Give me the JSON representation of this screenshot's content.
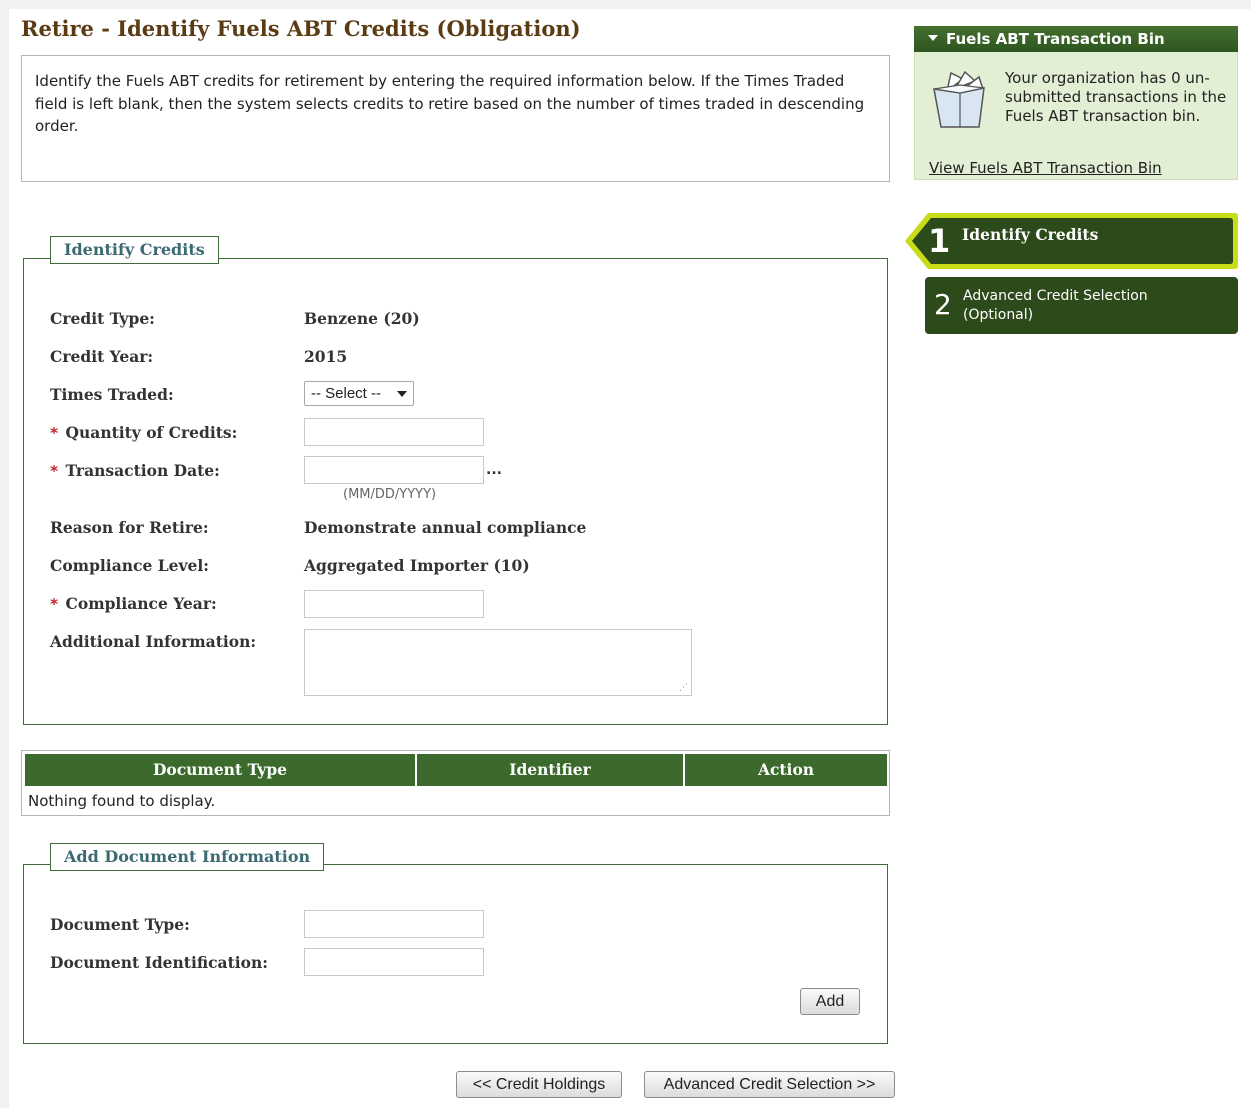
{
  "page": {
    "title": "Retire - Identify Fuels ABT Credits (Obligation)",
    "intro": "Identify the Fuels ABT credits for retirement by entering the required information below. If the Times Traded field is left blank, then the system selects credits to retire based on the number of times traded in descending order."
  },
  "identify": {
    "legend": "Identify Credits",
    "credit_type_label": "Credit Type:",
    "credit_type_value": "Benzene (20)",
    "credit_year_label": "Credit Year:",
    "credit_year_value": "2015",
    "times_traded_label": "Times Traded:",
    "times_traded_selected": "-- Select --",
    "quantity_label": "Quantity of Credits:",
    "quantity_value": "",
    "transaction_date_label": "Transaction Date:",
    "transaction_date_value": "",
    "date_picker_ellipsis": "...",
    "date_format_hint": "(MM/DD/YYYY)",
    "reason_label": "Reason for Retire:",
    "reason_value": "Demonstrate annual compliance",
    "compliance_level_label": "Compliance Level:",
    "compliance_level_value": "Aggregated Importer (10)",
    "compliance_year_label": "Compliance Year:",
    "compliance_year_value": "",
    "additional_info_label": "Additional Information:",
    "additional_info_value": "",
    "required_marker": "*"
  },
  "documents_table": {
    "columns": [
      "Document Type",
      "Identifier",
      "Action"
    ],
    "empty_message": "Nothing found to display."
  },
  "add_document": {
    "legend": "Add Document Information",
    "doc_type_label": "Document Type:",
    "doc_type_value": "",
    "doc_id_label": "Document Identification:",
    "doc_id_value": "",
    "add_button": "Add"
  },
  "nav_buttons": {
    "back": "<< Credit Holdings",
    "next": "Advanced Credit Selection >>"
  },
  "transaction_bin": {
    "header": "Fuels ABT Transaction Bin",
    "message": "Your organization has 0 un-submitted transactions in the Fuels ABT transaction bin.",
    "link": "View Fuels ABT Transaction Bin"
  },
  "steps": [
    {
      "number": "1",
      "label": "Identify Credits",
      "active": true
    },
    {
      "number": "2",
      "label_line1": "Advanced Credit Selection",
      "label_line2": "(Optional)",
      "active": false
    }
  ],
  "colors": {
    "title_brown": "#5a3b14",
    "header_green": "#3b6a2c",
    "step_dark_green": "#2d4a1b",
    "step_active_outline": "#c9dc1a",
    "bin_background": "#e3efd4",
    "required_red": "#c0282d",
    "legend_teal": "#3c6a72"
  }
}
